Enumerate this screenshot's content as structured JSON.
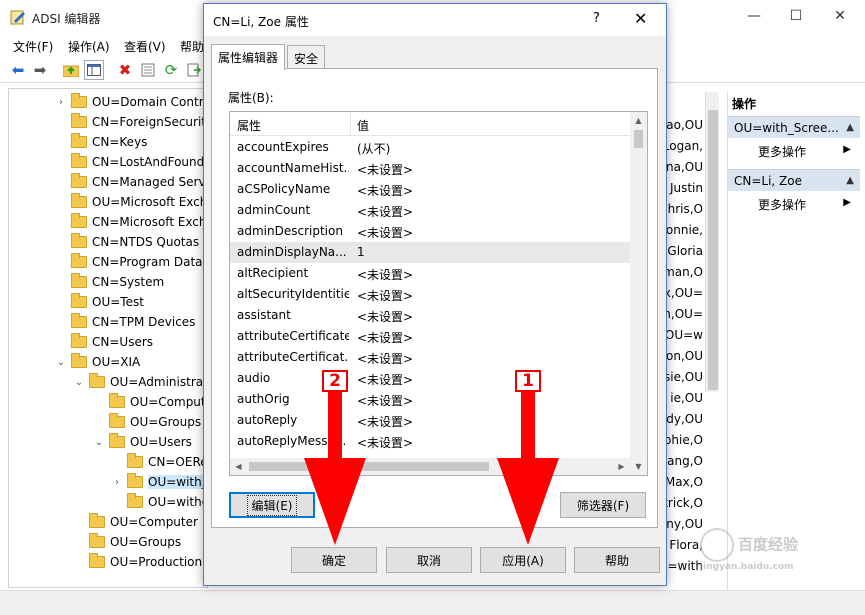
{
  "app": {
    "title": "ADSI 编辑器",
    "minimize": "—",
    "maximize": "☐",
    "close": "✕"
  },
  "menu": [
    "文件(F)",
    "操作(A)",
    "查看(V)",
    "帮助"
  ],
  "toolbar_icons": [
    "back-icon",
    "forward-icon",
    "up-folder-icon",
    "properties-panel-icon",
    "delete-icon",
    "export-icon",
    "refresh-icon",
    "export-list-icon"
  ],
  "tree": [
    {
      "label": "OU=Domain Contro",
      "level": 2,
      "expander": "›"
    },
    {
      "label": "CN=ForeignSecurity",
      "level": 2,
      "expander": ""
    },
    {
      "label": "CN=Keys",
      "level": 2,
      "expander": ""
    },
    {
      "label": "CN=LostAndFound",
      "level": 2,
      "expander": ""
    },
    {
      "label": "CN=Managed Serv",
      "level": 2,
      "expander": ""
    },
    {
      "label": "OU=Microsoft Exch",
      "level": 2,
      "expander": ""
    },
    {
      "label": "CN=Microsoft Exch",
      "level": 2,
      "expander": ""
    },
    {
      "label": "CN=NTDS Quotas",
      "level": 2,
      "expander": ""
    },
    {
      "label": "CN=Program Data",
      "level": 2,
      "expander": ""
    },
    {
      "label": "CN=System",
      "level": 2,
      "expander": ""
    },
    {
      "label": "OU=Test",
      "level": 2,
      "expander": ""
    },
    {
      "label": "CN=TPM Devices",
      "level": 2,
      "expander": ""
    },
    {
      "label": "CN=Users",
      "level": 2,
      "expander": ""
    },
    {
      "label": "OU=XIA",
      "level": 2,
      "expander": "⌄"
    },
    {
      "label": "OU=Administrat",
      "level": 3,
      "expander": "⌄"
    },
    {
      "label": "OU=Comput",
      "level": 4,
      "expander": ""
    },
    {
      "label": "OU=Groups",
      "level": 4,
      "expander": ""
    },
    {
      "label": "OU=Users",
      "level": 4,
      "expander": "⌄"
    },
    {
      "label": "CN=OERe",
      "level": 5,
      "expander": ""
    },
    {
      "label": "OU=with_",
      "level": 5,
      "expander": "›",
      "selected": true
    },
    {
      "label": "OU=witho",
      "level": 5,
      "expander": ""
    },
    {
      "label": "OU=Computer",
      "level": 3,
      "expander": ""
    },
    {
      "label": "OU=Groups",
      "level": 3,
      "expander": ""
    },
    {
      "label": "OU=Production",
      "level": 3,
      "expander": ""
    }
  ],
  "list_fragments": [
    "Hao,OU",
    "Logan,",
    "Tina,OU",
    "Justin",
    "Chris,O",
    "onnie,",
    "Gloria",
    "yman,O",
    "ex,OU=",
    "en,OU=",
    "OU=w",
    "on,OU",
    "ssie,OU",
    "ie,OU",
    "dy,OU",
    "ophie,O",
    "ang,O",
    "Max,O",
    "trick,O",
    "ny,OU",
    "Flora,",
    "OU=with"
  ],
  "actions": {
    "header": "操作",
    "sections": [
      {
        "title": "OU=with_Scree...",
        "link": "更多操作"
      },
      {
        "title": "CN=Li, Zoe",
        "link": "更多操作"
      }
    ]
  },
  "dialog": {
    "title": "CN=Li, Zoe 属性",
    "help": "?",
    "close": "✕",
    "tabs": [
      "属性编辑器",
      "安全"
    ],
    "attributes_label": "属性(B):",
    "columns": [
      "属性",
      "值"
    ],
    "rows": [
      {
        "name": "accountExpires",
        "value": "(从不)"
      },
      {
        "name": "accountNameHist...",
        "value": "<未设置>"
      },
      {
        "name": "aCSPolicyName",
        "value": "<未设置>"
      },
      {
        "name": "adminCount",
        "value": "<未设置>"
      },
      {
        "name": "adminDescription",
        "value": "<未设置>"
      },
      {
        "name": "adminDisplayNa...",
        "value": "1",
        "highlighted": true
      },
      {
        "name": "altRecipient",
        "value": "<未设置>"
      },
      {
        "name": "altSecurityIdentities",
        "value": "<未设置>"
      },
      {
        "name": "assistant",
        "value": "<未设置>"
      },
      {
        "name": "attributeCertificate",
        "value": "<未设置>"
      },
      {
        "name": "attributeCertificat...",
        "value": "<未设置>"
      },
      {
        "name": "audio",
        "value": "<未设置>"
      },
      {
        "name": "authOrig",
        "value": "<未设置>"
      },
      {
        "name": "autoReply",
        "value": "<未设置>"
      },
      {
        "name": "autoReplyMessa...",
        "value": "<未设置>"
      }
    ],
    "edit_button": "编辑(E)",
    "filter_button": "筛选器(F)",
    "ok_button": "确定",
    "cancel_button": "取消",
    "apply_button": "应用(A)",
    "help_button": "帮助"
  },
  "annotations": {
    "marker_1": "1",
    "marker_2": "2",
    "color": "#ff0000"
  },
  "watermark": {
    "text": "百度经验",
    "url": "jingyan.baidu.com"
  }
}
